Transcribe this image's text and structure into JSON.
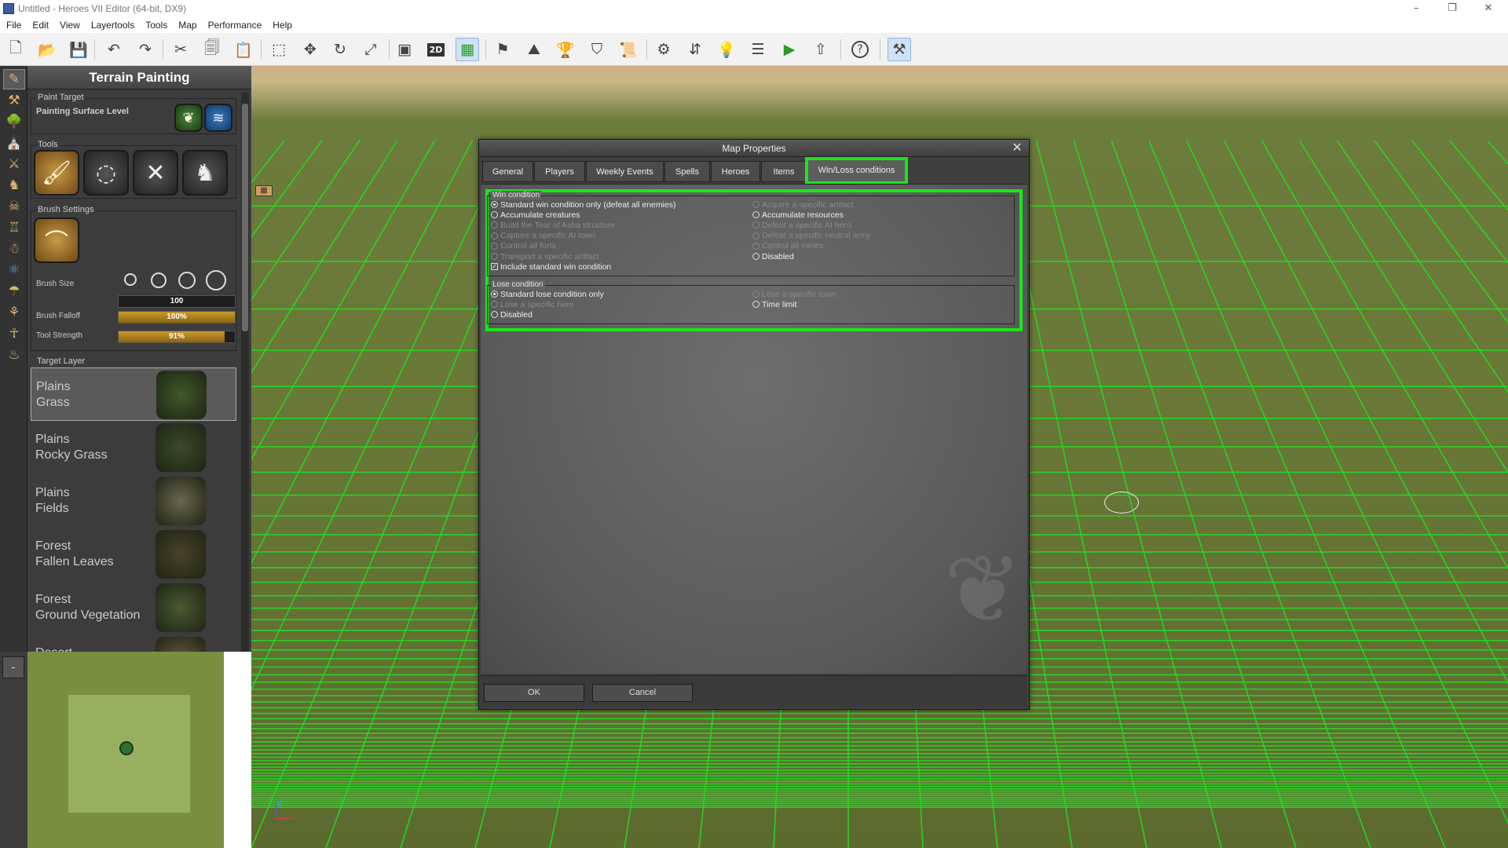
{
  "window": {
    "title": "Untitled - Heroes VII Editor (64-bit, DX9)",
    "controls": [
      "–",
      "❐",
      "✕"
    ]
  },
  "menu": [
    "File",
    "Edit",
    "View",
    "Layertools",
    "Tools",
    "Map",
    "Performance",
    "Help"
  ],
  "toolbar": {
    "icons": [
      "new-file-icon",
      "open-folder-icon",
      "save-icon",
      "undo-icon",
      "redo-icon",
      "cut-icon",
      "copy-icon",
      "paste-icon",
      "select-icon",
      "move-icon",
      "rotate-icon",
      "scale-icon",
      "camera-icon",
      "view-2d-icon",
      "grid-icon",
      "map-properties-icon",
      "terrain-icon",
      "trophy-icon",
      "helmet-icon",
      "scroll-icon",
      "settings-icon",
      "transfer-icon",
      "lightbulb-icon",
      "script-icon",
      "play-icon",
      "export-icon",
      "help-icon",
      "tools-icon"
    ],
    "glyphs": [
      "🗋",
      "📂",
      "💾",
      "↶",
      "↷",
      "✂",
      "🗐",
      "📋",
      "⬚",
      "✥",
      "↻",
      "⤢",
      "▣",
      "2D",
      "▦",
      "⚑",
      "⛰",
      "🏆",
      "⛉",
      "📜",
      "⚙",
      "⇵",
      "💡",
      "☰",
      "▶",
      "⇧",
      "?",
      "⚒"
    ]
  },
  "left_tools": [
    "✎",
    "⚒",
    "🌳",
    "⛪",
    "⚔",
    "♞",
    "☠",
    "♖",
    "☃",
    "⚛",
    "☂",
    "⚘",
    "☥",
    "♨"
  ],
  "terrain_panel": {
    "title": "Terrain Painting",
    "paint_target_label": "Paint Target",
    "painting_surface_level": "Painting Surface Level",
    "tools_label": "Tools",
    "brush_settings_label": "Brush Settings",
    "brush_size_label": "Brush Size",
    "brush_size_value": "100",
    "brush_falloff_label": "Brush Falloff",
    "brush_falloff_value": "100%",
    "brush_falloff_fraction": 1.0,
    "tool_strength_label": "Tool Strength",
    "tool_strength_value": "91%",
    "tool_strength_fraction": 0.91,
    "target_layer_label": "Target Layer",
    "layers": [
      {
        "line1": "Plains",
        "line2": "Grass",
        "color": "#3e5a2a"
      },
      {
        "line1": "Plains",
        "line2": "Rocky Grass",
        "color": "#3a4a2a"
      },
      {
        "line1": "Plains",
        "line2": "Fields",
        "color": "#6b6650"
      },
      {
        "line1": "Forest",
        "line2": "Fallen Leaves",
        "color": "#4a4228"
      },
      {
        "line1": "Forest",
        "line2": "Ground Vegetation",
        "color": "#4a5a30"
      },
      {
        "line1": "Desert",
        "line2": "",
        "color": "#6a5a40"
      }
    ]
  },
  "dialog": {
    "title": "Map Properties",
    "tabs": [
      "General",
      "Players",
      "Weekly Events",
      "Spells",
      "Heroes",
      "Items",
      "Win/Loss conditions"
    ],
    "active_tab": "Win/Loss conditions",
    "win": {
      "legend": "Win condition",
      "left": [
        {
          "label": "Standard win condition only (defeat all enemies)",
          "type": "radio",
          "checked": true,
          "enabled": true
        },
        {
          "label": "Accumulate creatures",
          "type": "radio",
          "checked": false,
          "enabled": true
        },
        {
          "label": "Build the Tear of Asha structure",
          "type": "radio",
          "checked": false,
          "enabled": false
        },
        {
          "label": "Capture a specific AI town",
          "type": "radio",
          "checked": false,
          "enabled": false
        },
        {
          "label": "Control all forts",
          "type": "radio",
          "checked": false,
          "enabled": false
        },
        {
          "label": "Transport a specific artifact",
          "type": "radio",
          "checked": false,
          "enabled": false
        },
        {
          "label": "Include standard win condition",
          "type": "checkbox",
          "checked": true,
          "enabled": true
        }
      ],
      "right": [
        {
          "label": "Acquire a specific artifact",
          "type": "radio",
          "checked": false,
          "enabled": false
        },
        {
          "label": "Accumulate resources",
          "type": "radio",
          "checked": false,
          "enabled": true
        },
        {
          "label": "Defeat a specific AI hero",
          "type": "radio",
          "checked": false,
          "enabled": false
        },
        {
          "label": "Defeat a specific neutral army",
          "type": "radio",
          "checked": false,
          "enabled": false
        },
        {
          "label": "Control all mines",
          "type": "radio",
          "checked": false,
          "enabled": false
        },
        {
          "label": "Disabled",
          "type": "radio",
          "checked": false,
          "enabled": true
        }
      ]
    },
    "lose": {
      "legend": "Lose condition",
      "left": [
        {
          "label": "Standard lose condition only",
          "type": "radio",
          "checked": true,
          "enabled": true
        },
        {
          "label": "Lose a specific hero",
          "type": "radio",
          "checked": false,
          "enabled": false
        },
        {
          "label": "Disabled",
          "type": "radio",
          "checked": false,
          "enabled": true
        }
      ],
      "right": [
        {
          "label": "Lose a specific town",
          "type": "radio",
          "checked": false,
          "enabled": false
        },
        {
          "label": "Time limit",
          "type": "radio",
          "checked": false,
          "enabled": true
        }
      ]
    },
    "ok_label": "OK",
    "cancel_label": "Cancel",
    "close_glyph": "✕"
  },
  "colors": {
    "highlight": "#18e818",
    "grid": "#22dd22",
    "brush_gold": "#c99a2a"
  },
  "minimap": {
    "collapse_label": "-"
  },
  "axis_label": "Z"
}
